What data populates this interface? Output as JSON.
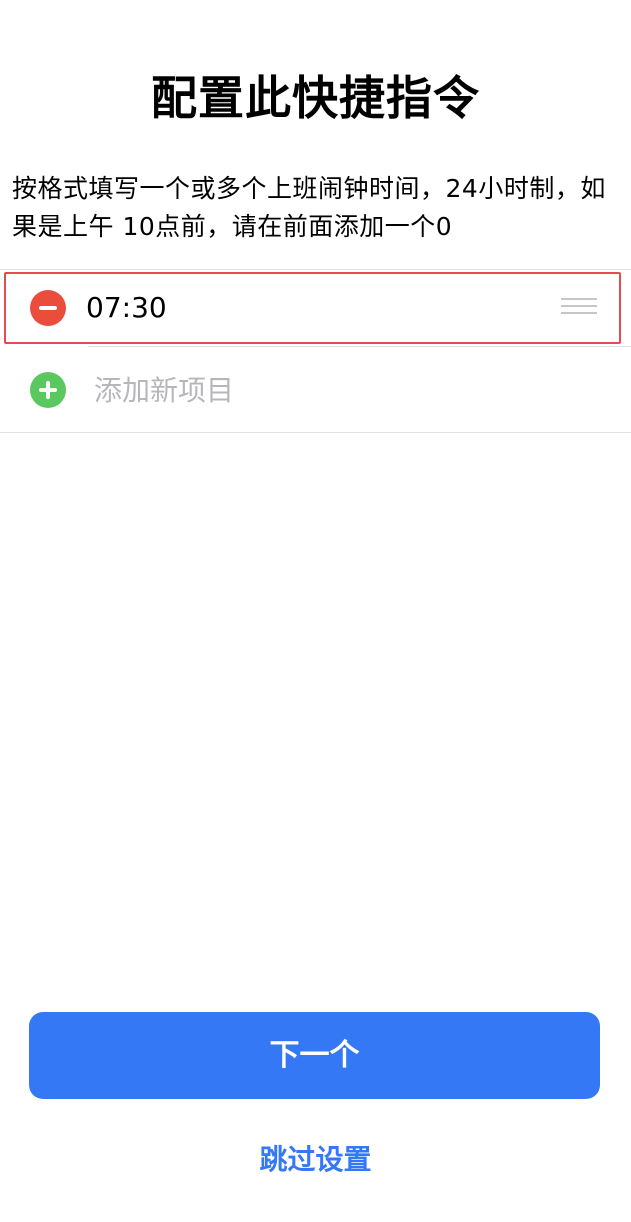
{
  "header": {
    "title": "配置此快捷指令",
    "description": "按格式填写一个或多个上班闹钟时间，24小时制，如果是上午 10点前，请在前面添加一个0"
  },
  "list": {
    "items": [
      {
        "value": "07:30"
      }
    ],
    "add_placeholder": "添加新项目"
  },
  "footer": {
    "next_label": "下一个",
    "skip_label": "跳过设置"
  },
  "colors": {
    "accent": "#3478f6",
    "delete": "#eb4d3d",
    "add": "#5ac85e",
    "highlight": "#e74a4f"
  }
}
